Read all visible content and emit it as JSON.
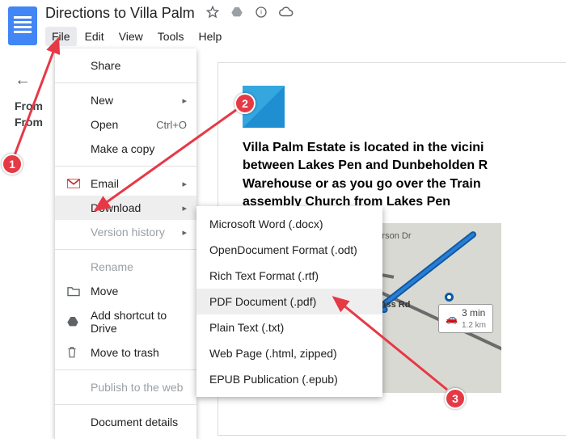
{
  "header": {
    "title": "Directions to Villa Palm",
    "menus": [
      "File",
      "Edit",
      "View",
      "Tools",
      "Help"
    ],
    "active_menu": 0
  },
  "left_stub": {
    "lines": [
      "From",
      "From"
    ]
  },
  "file_menu": {
    "share": "Share",
    "new": "New",
    "open": "Open",
    "open_shortcut": "Ctrl+O",
    "make_copy": "Make a copy",
    "email": "Email",
    "download": "Download",
    "version_history": "Version history",
    "rename": "Rename",
    "move": "Move",
    "add_shortcut": "Add shortcut to Drive",
    "move_trash": "Move to trash",
    "publish": "Publish to the web",
    "doc_details": "Document details"
  },
  "download_submenu": {
    "docx": "Microsoft Word (.docx)",
    "odt": "OpenDocument Format (.odt)",
    "rtf": "Rich Text Format (.rtf)",
    "pdf": "PDF Document (.pdf)",
    "txt": "Plain Text (.txt)",
    "html": "Web Page (.html, zipped)",
    "epub": "EPUB Publication (.epub)"
  },
  "doc_body": {
    "paragraph": "Villa Palm Estate is located in the vicini\nbetween Lakes Pen and Dunbeholden R\nWarehouse or as you go over the Train\nassembly Church from Lakes Pen"
  },
  "map": {
    "street1": "Henderson Dr",
    "street2": "ByPass Rd",
    "route_time": "3 min",
    "route_dist": "1.2 km"
  },
  "annotations": {
    "one": "1",
    "two": "2",
    "three": "3"
  }
}
